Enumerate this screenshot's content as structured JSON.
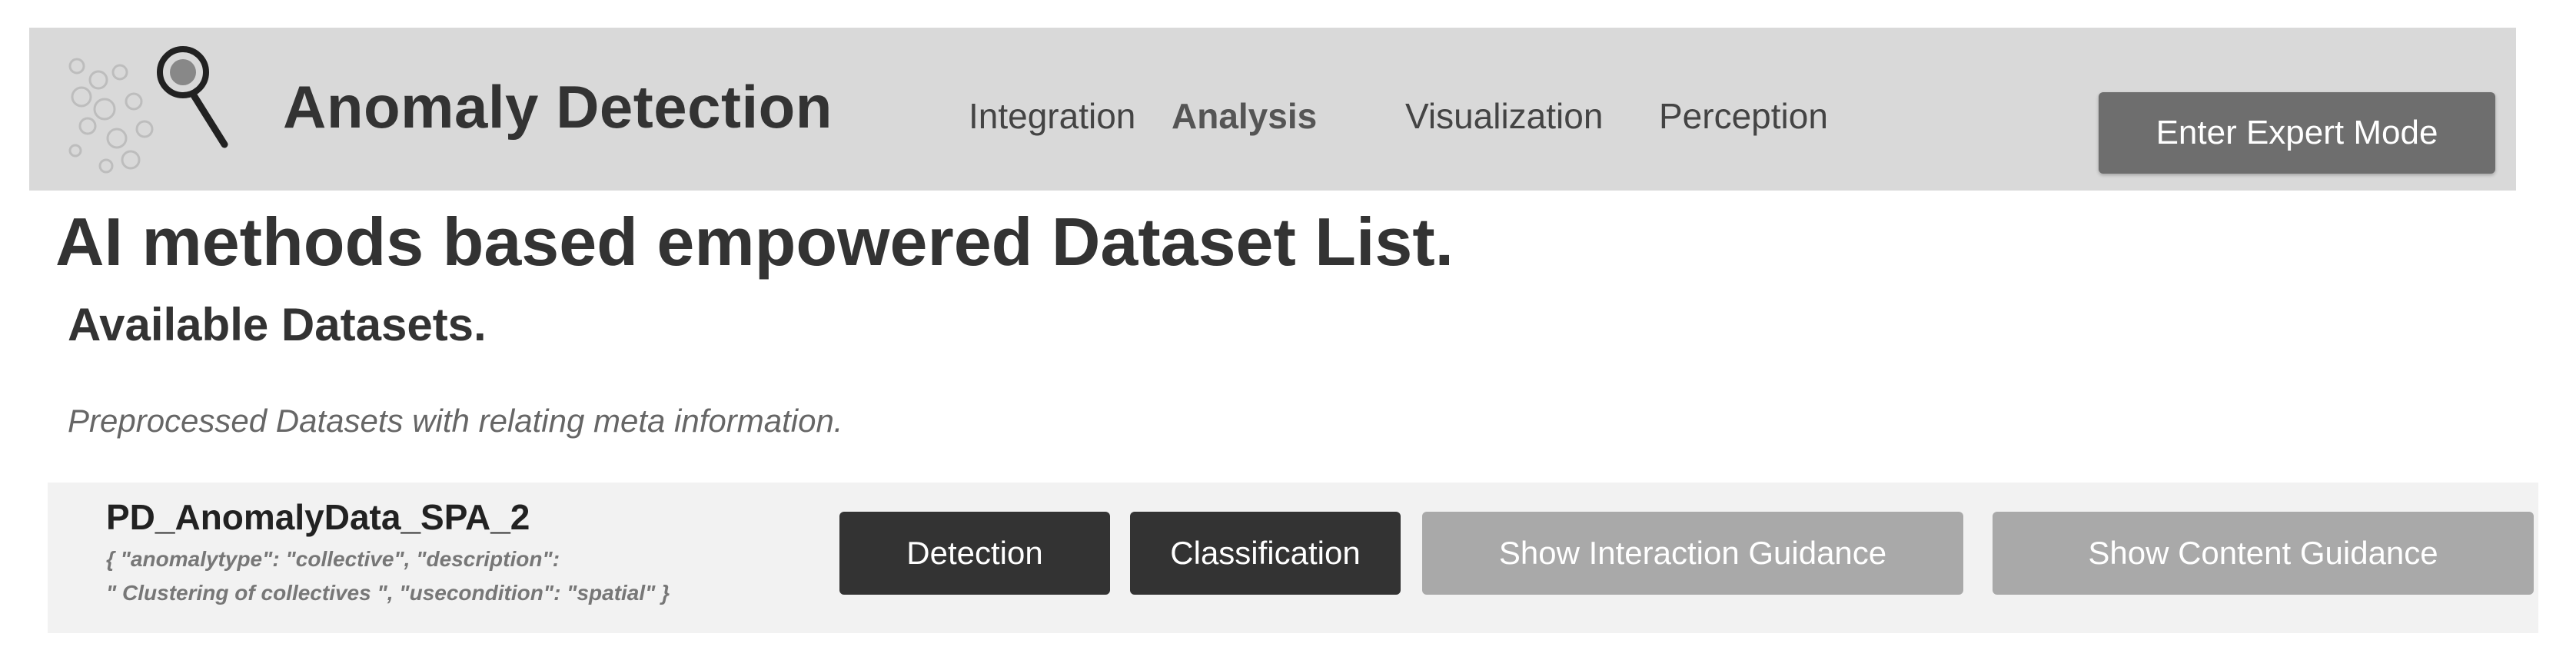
{
  "header": {
    "app_title": "Anomaly Detection",
    "logo_icon": "magnifier-bubbles-icon",
    "nav": [
      {
        "label": "Integration",
        "active": false
      },
      {
        "label": "Analysis",
        "active": true
      },
      {
        "label": "Visualization",
        "active": false
      },
      {
        "label": "Perception",
        "active": false
      }
    ],
    "expert_mode_label": "Enter Expert Mode"
  },
  "main": {
    "page_title": "AI methods based empowered Dataset List.",
    "section_title": "Available Datasets.",
    "section_subtitle": "Preprocessed Datasets with relating meta information."
  },
  "datasets": [
    {
      "name": "PD_AnomalyData_SPA_2",
      "meta_line1": "{ \"anomalytype\": \"collective\", \"description\":",
      "meta_line2": "\" Clustering of collectives \", \"usecondition\": \"spatial\" }",
      "buttons": {
        "detection": "Detection",
        "classification": "Classification",
        "interaction_guidance": "Show Interaction Guidance",
        "content_guidance": "Show Content Guidance"
      }
    }
  ],
  "colors": {
    "header_bg": "#d9d9d9",
    "dark_button": "#333333",
    "light_button": "#a9a9a9",
    "expert_button": "#6e6e6e",
    "row_bg": "#f2f2f2"
  }
}
